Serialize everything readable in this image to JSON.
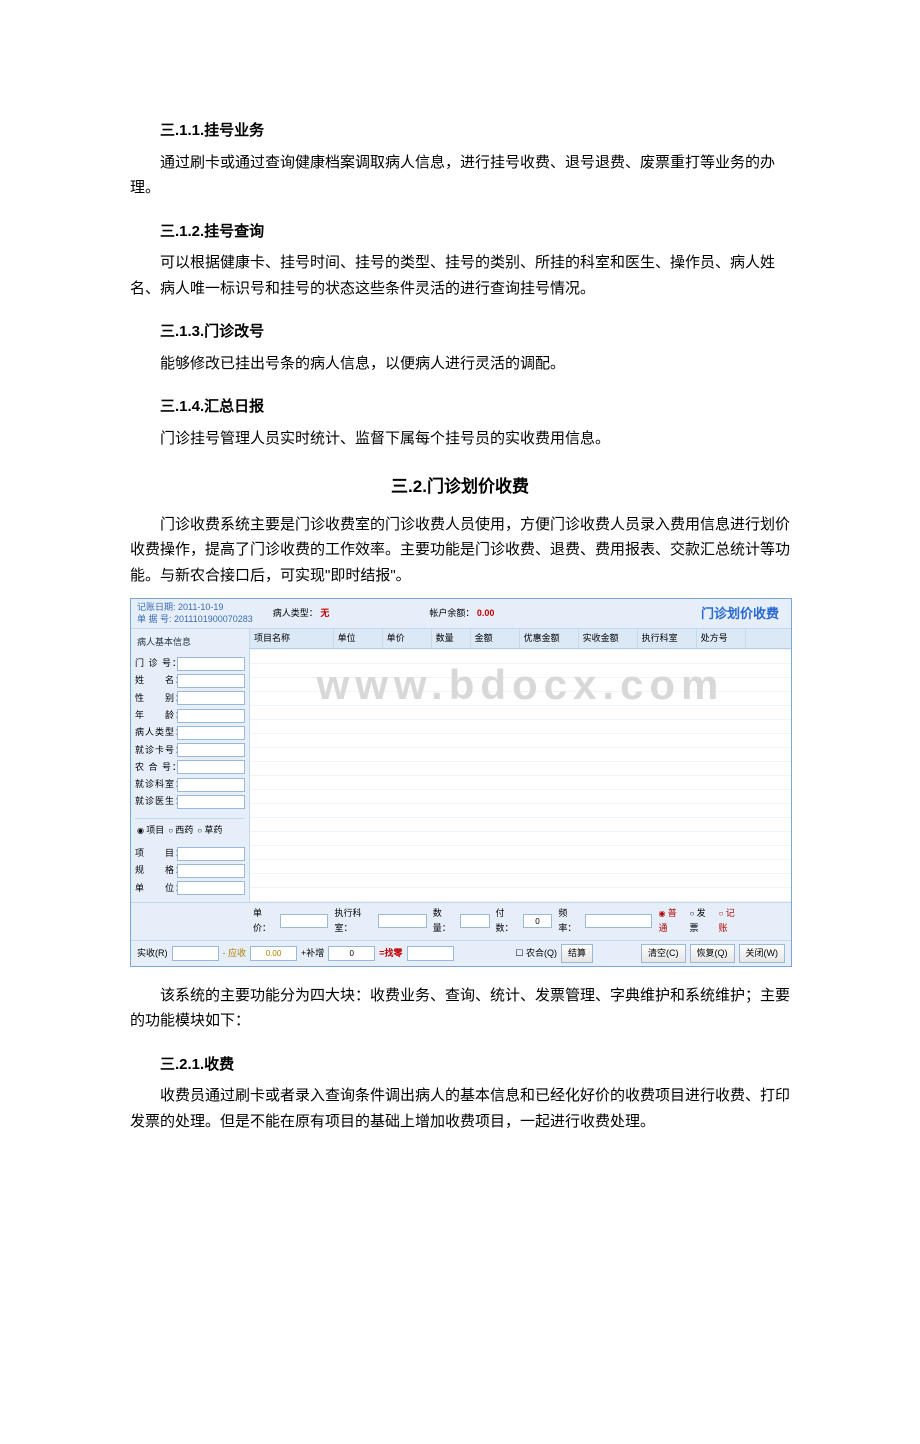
{
  "h311": "三.1.1.挂号业务",
  "p311": "通过刷卡或通过查询健康档案调取病人信息，进行挂号收费、退号退费、废票重打等业务的办理。",
  "h312": "三.1.2.挂号查询",
  "p312": "可以根据健康卡、挂号时间、挂号的类型、挂号的类别、所挂的科室和医生、操作员、病人姓名、病人唯一标识号和挂号的状态这些条件灵活的进行查询挂号情况。",
  "h313": "三.1.3.门诊改号",
  "p313": "能够修改已挂出号条的病人信息，以便病人进行灵活的调配。",
  "h314": "三.1.4.汇总日报",
  "p314": "门诊挂号管理人员实时统计、监督下属每个挂号员的实收费用信息。",
  "h32": "三.2.门诊划价收费",
  "p32a": "门诊收费系统主要是门诊收费室的门诊收费人员使用，方便门诊收费人员录入费用信息进行划价收费操作，提高了门诊收费的工作效率。主要功能是门诊收费、退费、费用报表、交款汇总统计等功能。与新农合接口后，可实现\"即时结报\"。",
  "p32b": "该系统的主要功能分为四大块：收费业务、查询、统计、发票管理、字典维护和系统维护；主要的功能模块如下：",
  "h321": "三.2.1.收费",
  "p321": "收费员通过刷卡或者录入查询条件调出病人的基本信息和已经化好价的收费项目进行收费、打印发票的处理。但是不能在原有项目的基础上增加收费项目，一起进行收费处理。",
  "screen": {
    "record_date_label": "记账日期:",
    "record_date": "2011-10-19",
    "bill_label": "单 据 号:",
    "bill_no": "2011101900070283",
    "ptype_label": "病人类型：",
    "ptype_value": "无",
    "acct_label": "帐户余额：",
    "acct_value": "0.00",
    "title": "门诊划价收费",
    "sidebar": {
      "title": "病人基本信息",
      "f_mzh": "门 诊 号：",
      "f_xm": "姓　　名：",
      "f_xb": "性　　别：",
      "f_nl": "年　　龄：",
      "f_brlx": "病人类型：",
      "f_jzk": "就诊卡号：",
      "f_nhh": "农 合 号：",
      "f_jzks": "就诊科室：",
      "f_jzys": "就诊医生：",
      "r_xm": "项目",
      "r_xy": "西药",
      "r_zy": "草药",
      "f_item": "项　　目：",
      "f_gg": "规　　格：",
      "f_dw": "单　　位："
    },
    "columns": {
      "c1": "项目名称",
      "c2": "单位",
      "c3": "单价",
      "c4": "数量",
      "c5": "金额",
      "c6": "优惠金额",
      "c7": "实收金额",
      "c8": "执行科室",
      "c9": "处方号"
    },
    "watermark": "www.bdocx.com",
    "lower1": {
      "unit_price": "单价：",
      "exec_dept": "执行科室：",
      "qty": "数量：",
      "doses": "付数：",
      "doses_v": "0",
      "freq": "频率：",
      "r_pt": "普通",
      "r_fp": "发票",
      "r_jz": "记账"
    },
    "lower2": {
      "ss": "实收(R)",
      "ys": "应收",
      "ys_v": "0.00",
      "bz": "+补增",
      "bz_v": "0",
      "zl": "=找零",
      "nhchk": "农合(Q)",
      "btn_settle": "结算",
      "btn_clear": "清空(C)",
      "btn_recover": "恢复(Q)",
      "btn_close": "关闭(W)"
    }
  }
}
